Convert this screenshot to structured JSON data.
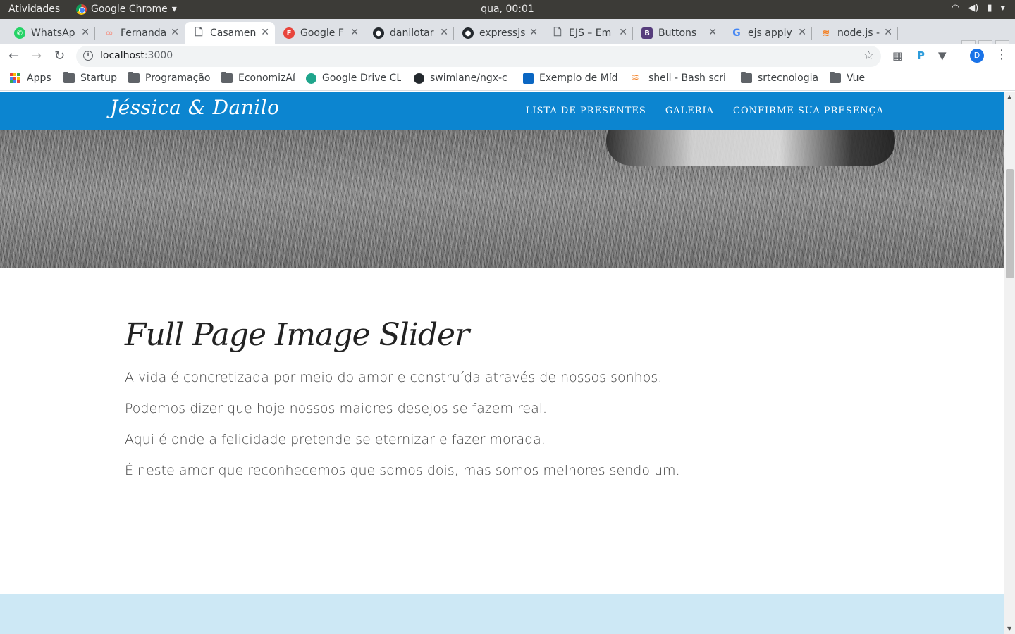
{
  "os_bar": {
    "activities": "Atividades",
    "app_name": "Google Chrome",
    "clock": "qua, 00:01"
  },
  "tabs": [
    {
      "label": "WhatsAp",
      "favicon": "whatsapp-icon",
      "color": "#25d366"
    },
    {
      "label": "Fernanda",
      "favicon": "link-icon",
      "color": "#f29b8f"
    },
    {
      "label": "Casamen",
      "favicon": "page-icon",
      "color": "#5f6368",
      "active": true
    },
    {
      "label": "Google F",
      "favicon": "firebase-icon",
      "color": "#e8453c"
    },
    {
      "label": "danilotar",
      "favicon": "github-icon",
      "color": "#24292e"
    },
    {
      "label": "expressjs",
      "favicon": "github-icon",
      "color": "#24292e"
    },
    {
      "label": "EJS – Em",
      "favicon": "page-icon",
      "color": "#5f6368"
    },
    {
      "label": "Buttons",
      "favicon": "bootstrap-icon",
      "color": "#563d7c"
    },
    {
      "label": "ejs apply",
      "favicon": "google-icon",
      "color": "#4285f4"
    },
    {
      "label": "node.js -",
      "favicon": "stackoverflow-icon",
      "color": "#f48024"
    }
  ],
  "omnibox": {
    "host": "localhost",
    "port": ":3000"
  },
  "bookmarks": [
    {
      "label": "Apps",
      "icon": "apps-grid-icon"
    },
    {
      "label": "Startup",
      "icon": "folder-icon"
    },
    {
      "label": "Programação",
      "icon": "folder-icon"
    },
    {
      "label": "EconomizAí",
      "icon": "folder-icon"
    },
    {
      "label": "Google Drive CLI",
      "icon": "drive-icon"
    },
    {
      "label": "swimlane/ngx-c",
      "icon": "github-icon"
    },
    {
      "label": "Exemplo de Mídi",
      "icon": "linkedin-icon"
    },
    {
      "label": "shell - Bash scrip",
      "icon": "stackoverflow-icon"
    },
    {
      "label": "srtecnologia",
      "icon": "folder-icon"
    },
    {
      "label": "Vue",
      "icon": "folder-icon"
    }
  ],
  "site": {
    "brand": "Jéssica & Danilo",
    "nav": [
      "LISTA DE PRESENTES",
      "GALERIA",
      "CONFIRME SUA PRESENÇA"
    ],
    "heading": "Full Page Image Slider",
    "paragraphs": [
      "A vida é concretizada por meio do amor e construída através de nossos sonhos.",
      "Podemos dizer que hoje nossos maiores desejos se fazem real.",
      "Aqui é onde a felicidade pretende se eternizar e fazer morada.",
      "É neste amor que reconhecemos que somos dois, mas somos melhores sendo um."
    ],
    "accent_color": "#0c85d0",
    "band_color": "#cde8f5"
  },
  "profile": {
    "initial": "D"
  }
}
